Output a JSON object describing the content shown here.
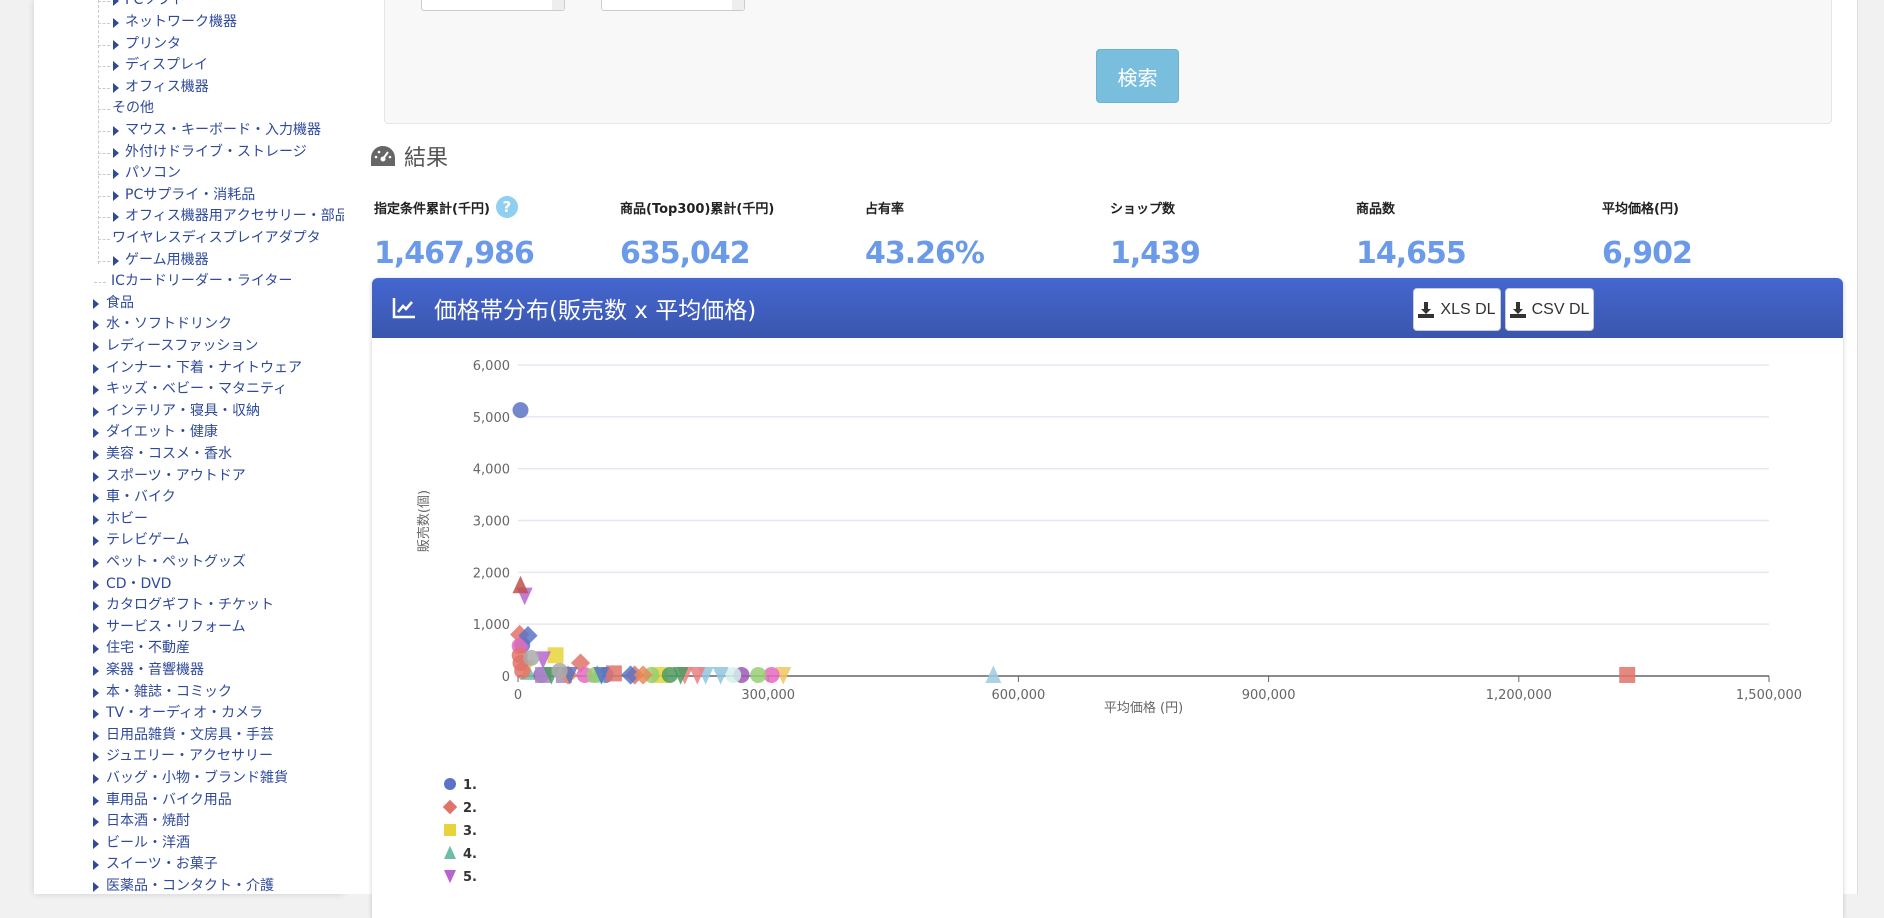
{
  "sidebar": {
    "sub_items": [
      {
        "label": "PCソフト",
        "arrow": true,
        "level": 2
      },
      {
        "label": "ネットワーク機器",
        "arrow": true,
        "level": 2
      },
      {
        "label": "プリンタ",
        "arrow": true,
        "level": 2
      },
      {
        "label": "ディスプレイ",
        "arrow": true,
        "level": 2
      },
      {
        "label": "オフィス機器",
        "arrow": true,
        "level": 2
      },
      {
        "label": "その他",
        "arrow": false,
        "level": 2
      },
      {
        "label": "マウス・キーボード・入力機器",
        "arrow": true,
        "level": 2
      },
      {
        "label": "外付けドライブ・ストレージ",
        "arrow": true,
        "level": 2
      },
      {
        "label": "パソコン",
        "arrow": true,
        "level": 2
      },
      {
        "label": "PCサプライ・消耗品",
        "arrow": true,
        "level": 2
      },
      {
        "label": "オフィス機器用アクセサリー・部品",
        "arrow": true,
        "level": 2
      },
      {
        "label": "ワイヤレスディスプレイアダプタ",
        "arrow": false,
        "level": 2
      },
      {
        "label": "ゲーム用機器",
        "arrow": true,
        "level": 2
      },
      {
        "label": "ICカードリーダー・ライター",
        "arrow": false,
        "level": 1
      }
    ],
    "categories": [
      "食品",
      "水・ソフトドリンク",
      "レディースファッション",
      "インナー・下着・ナイトウェア",
      "キッズ・ベビー・マタニティ",
      "インテリア・寝具・収納",
      "ダイエット・健康",
      "美容・コスメ・香水",
      "スポーツ・アウトドア",
      "車・バイク",
      "ホビー",
      "テレビゲーム",
      "ペット・ペットグッズ",
      "CD・DVD",
      "カタログギフト・チケット",
      "サービス・リフォーム",
      "住宅・不動産",
      "楽器・音響機器",
      "本・雑誌・コミック",
      "TV・オーディオ・カメラ",
      "日用品雑貨・文房具・手芸",
      "ジュエリー・アクセサリー",
      "バッグ・小物・ブランド雑貨",
      "車用品・バイク用品",
      "日本酒・焼酎",
      "ビール・洋酒",
      "スイーツ・お菓子",
      "医薬品・コンタクト・介護"
    ]
  },
  "search": {
    "button_label": "検索"
  },
  "results": {
    "title": "結果",
    "stats": [
      {
        "label": "指定条件累計(千円)",
        "value": "1,467,986",
        "help": "?"
      },
      {
        "label": "商品(Top300)累計(千円)",
        "value": "635,042"
      },
      {
        "label": "占有率",
        "value": "43.26%"
      },
      {
        "label": "ショップ数",
        "value": "1,439"
      },
      {
        "label": "商品数",
        "value": "14,655"
      },
      {
        "label": "平均価格(円)",
        "value": "6,902"
      }
    ]
  },
  "chart_panel": {
    "title": "価格帯分布(販売数 x 平均価格)",
    "xls_label": "XLS DL",
    "csv_label": "CSV DL"
  },
  "chart_data": {
    "type": "scatter",
    "title": "価格帯分布(販売数 x 平均価格)",
    "xlabel": "平均価格 (円)",
    "ylabel": "販売数(個)",
    "xlim": [
      0,
      1500000
    ],
    "ylim": [
      0,
      6000
    ],
    "xticks": [
      "0",
      "300,000",
      "600,000",
      "900,000",
      "1,200,000",
      "1,500,000"
    ],
    "yticks": [
      "0",
      "1,000",
      "2,000",
      "3,000",
      "4,000",
      "5,000",
      "6,000"
    ],
    "grid": true,
    "legend_position": "bottom-left",
    "series": [
      {
        "name": "1.",
        "color": "#5b73c4",
        "shape": "circle",
        "points": [
          [
            3000,
            5130
          ],
          [
            105000,
            20
          ],
          [
            5000,
            600
          ]
        ]
      },
      {
        "name": "2.",
        "color": "#e0736a",
        "shape": "diamond",
        "points": [
          [
            75000,
            250
          ],
          [
            2000,
            800
          ],
          [
            140000,
            20
          ]
        ]
      },
      {
        "name": "3.",
        "color": "#e8d33a",
        "shape": "square",
        "points": [
          [
            45000,
            400
          ],
          [
            170000,
            20
          ]
        ]
      },
      {
        "name": "4.",
        "color": "#6dbca5",
        "shape": "triangle",
        "points": [
          [
            12000,
            80
          ],
          [
            95000,
            30
          ]
        ]
      },
      {
        "name": "5.",
        "color": "#b565d0",
        "shape": "triangle-down",
        "points": [
          [
            8000,
            1550
          ],
          [
            30000,
            320
          ]
        ]
      },
      {
        "name": "",
        "color": "#c0504d",
        "shape": "triangle",
        "points": [
          [
            3000,
            1750
          ]
        ]
      },
      {
        "name": "",
        "color": "#e0736a",
        "shape": "square",
        "points": [
          [
            1330000,
            20
          ],
          [
            115000,
            50
          ]
        ]
      },
      {
        "name": "",
        "color": "#9ecae1",
        "shape": "triangle",
        "points": [
          [
            570000,
            20
          ]
        ]
      },
      {
        "name": "",
        "color": "#f0c75e",
        "shape": "triangle-down",
        "points": [
          [
            318000,
            20
          ],
          [
            10000,
            150
          ]
        ]
      },
      {
        "name": "",
        "color": "#e46bbf",
        "shape": "circle",
        "points": [
          [
            304000,
            20
          ],
          [
            2000,
            580
          ],
          [
            80000,
            20
          ]
        ]
      },
      {
        "name": "",
        "color": "#97cf72",
        "shape": "circle",
        "points": [
          [
            288000,
            20
          ],
          [
            92000,
            20
          ],
          [
            160000,
            20
          ]
        ]
      },
      {
        "name": "",
        "color": "#9b59b6",
        "shape": "circle",
        "points": [
          [
            268000,
            20
          ],
          [
            28000,
            20
          ]
        ]
      },
      {
        "name": "",
        "color": "#d5f0ea",
        "shape": "circle",
        "points": [
          [
            258000,
            20
          ]
        ]
      },
      {
        "name": "",
        "color": "#8fc6e0",
        "shape": "triangle-down",
        "points": [
          [
            243000,
            20
          ],
          [
            225000,
            20
          ]
        ]
      },
      {
        "name": "",
        "color": "#ec7f7f",
        "shape": "triangle-down",
        "points": [
          [
            215000,
            20
          ],
          [
            200000,
            20
          ]
        ]
      },
      {
        "name": "",
        "color": "#4c9a5f",
        "shape": "circle",
        "points": [
          [
            182000,
            20
          ]
        ]
      },
      {
        "name": "",
        "color": "#5b73c4",
        "shape": "diamond",
        "points": [
          [
            135000,
            20
          ],
          [
            12000,
            780
          ]
        ]
      },
      {
        "name": "",
        "color": "#a888c8",
        "shape": "square",
        "points": [
          [
            30000,
            20
          ],
          [
            55000,
            20
          ]
        ]
      },
      {
        "name": "",
        "color": "#e88b5a",
        "shape": "diamond",
        "points": [
          [
            60000,
            20
          ],
          [
            150000,
            20
          ]
        ]
      },
      {
        "name": "",
        "color": "#5b73c4",
        "shape": "triangle-down",
        "points": [
          [
            62000,
            20
          ],
          [
            100000,
            20
          ]
        ]
      },
      {
        "name": "",
        "color": "#4c9a5f",
        "shape": "triangle-down",
        "points": [
          [
            40000,
            20
          ],
          [
            195000,
            20
          ]
        ]
      },
      {
        "name": "",
        "color": "#e0736a",
        "shape": "circle",
        "points": [
          [
            2000,
            400
          ],
          [
            3000,
            250
          ],
          [
            5000,
            100
          ]
        ]
      },
      {
        "name": "",
        "color": "#aaaaaa",
        "shape": "circle",
        "points": [
          [
            16000,
            350
          ],
          [
            50000,
            100
          ]
        ]
      }
    ]
  }
}
